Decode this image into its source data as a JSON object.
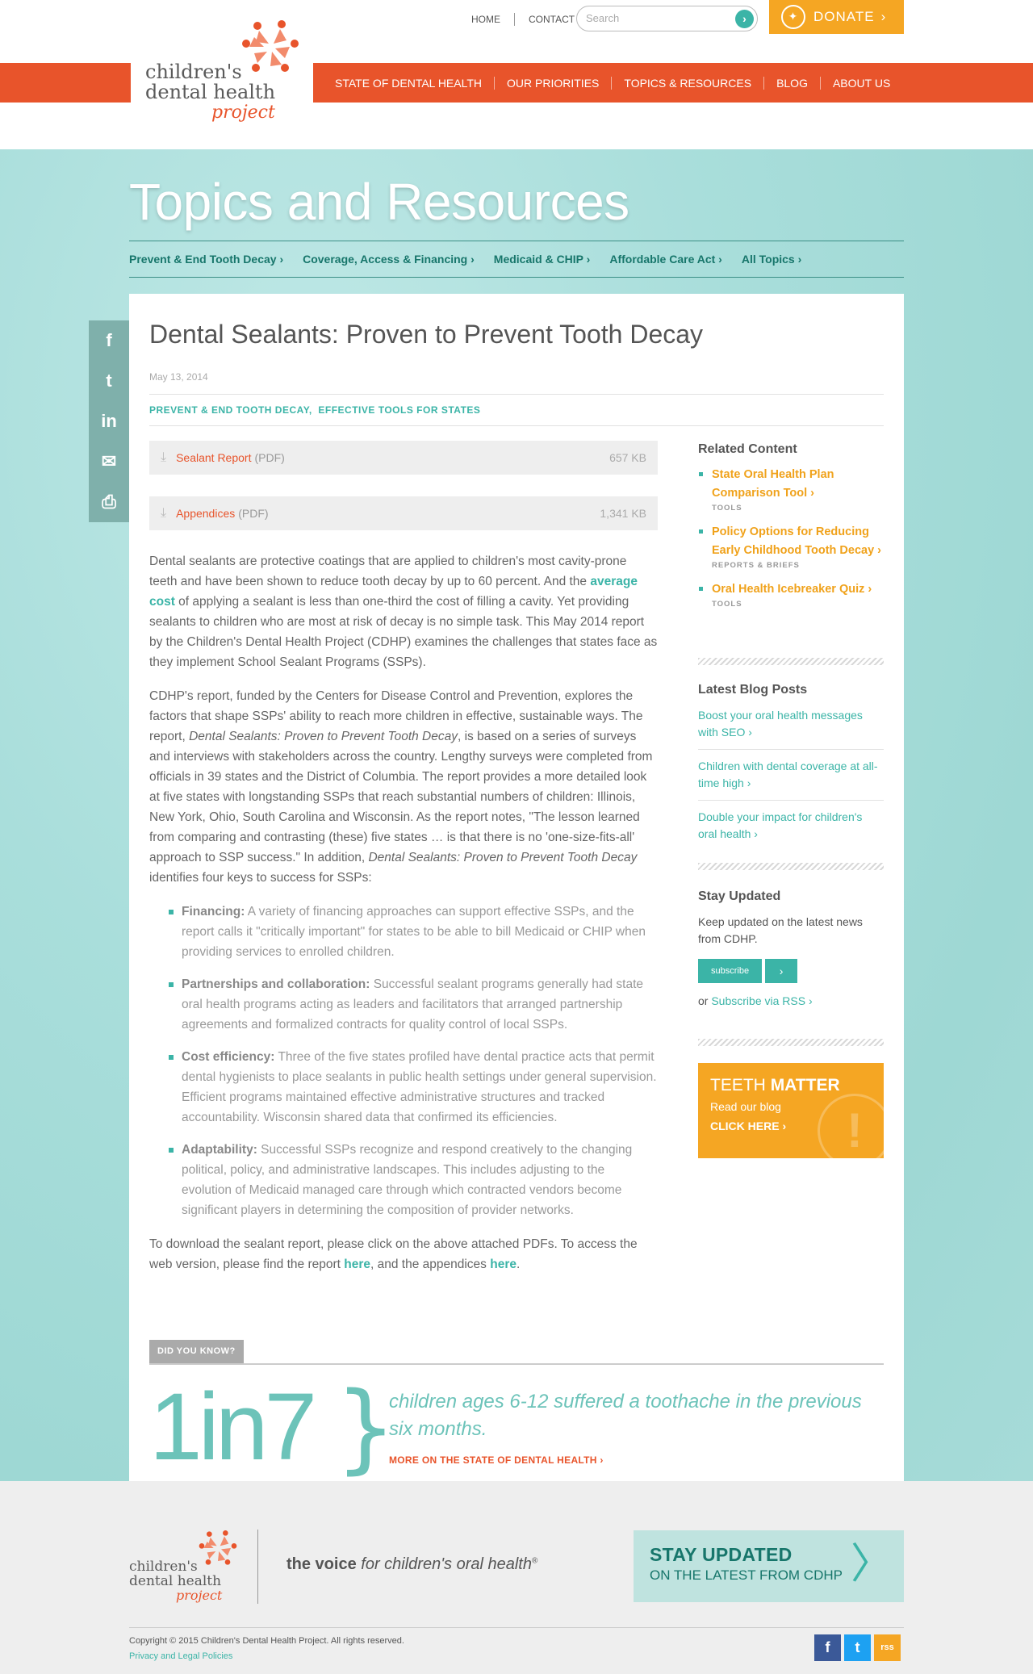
{
  "header": {
    "topnav": [
      "HOME",
      "CONTACT"
    ],
    "search_placeholder": "Search",
    "donate_label": "DONATE",
    "donate_arrow": "›",
    "logo_line1": "children's",
    "logo_line2": "dental health",
    "logo_line3": "project",
    "mainnav": [
      "STATE OF DENTAL HEALTH",
      "OUR PRIORITIES",
      "TOPICS & RESOURCES",
      "BLOG",
      "ABOUT US"
    ]
  },
  "hero": {
    "title": "Topics and Resources",
    "subnav": [
      "Prevent & End Tooth Decay ›",
      "Coverage, Access & Financing ›",
      "Medicaid & CHIP ›",
      "Affordable Care Act ›",
      "All Topics ›"
    ]
  },
  "share": {
    "icons": [
      "facebook-icon",
      "twitter-icon",
      "linkedin-icon",
      "email-icon",
      "print-icon"
    ],
    "glyphs": [
      "f",
      "t",
      "in",
      "✉",
      "⎙"
    ]
  },
  "article": {
    "title": "Dental Sealants: Proven to Prevent Tooth Decay",
    "date": "May 13, 2014",
    "tag1": "PREVENT & END TOOTH DECAY",
    "tag_sep": ",",
    "tag2": "EFFECTIVE TOOLS FOR STATES",
    "downloads": [
      {
        "name": "Sealant Report",
        "type": "(PDF)",
        "size": "657 KB"
      },
      {
        "name": "Appendices",
        "type": "(PDF)",
        "size": "1,341 KB"
      }
    ],
    "p1_a": "Dental sealants are protective coatings that are applied to children's most cavity-prone teeth and have been shown to reduce tooth decay by up to 60 percent. And the ",
    "p1_link": "average cost",
    "p1_b": " of applying a sealant is less than one-third the cost of filling a cavity. Yet providing sealants to children who are most at risk of decay is no simple task. This May 2014 report by the Children's Dental Health Project (CDHP) examines the challenges that states face as they implement School Sealant Programs (SSPs).",
    "p2_a": "CDHP's report, funded by the Centers for Disease Control and Prevention, explores the factors that shape SSPs' ability to reach more children in effective, sustainable ways. The report, ",
    "p2_i1": "Dental Sealants: Proven to Prevent Tooth Decay",
    "p2_b": ", is based on a series of surveys and interviews with stakeholders across the country. Lengthy surveys were completed from officials in 39 states and the District of Columbia. The report provides a more detailed look at five states with longstanding SSPs that reach substantial numbers of children: Illinois, New York, Ohio, South Carolina and Wisconsin. As the report notes, \"The lesson learned from comparing and contrasting (these) five states … is that there is no 'one-size-fits-all' approach to SSP success.\" In addition, ",
    "p2_i2": "Dental Sealants: Proven to Prevent Tooth Decay",
    "p2_c": " identifies four keys to success for SSPs:",
    "keys": [
      {
        "label": "Financing:",
        "text": " A variety of financing approaches can support effective SSPs, and the report calls it \"critically important\" for states to be able to bill Medicaid or CHIP when providing services to enrolled children."
      },
      {
        "label": "Partnerships and collaboration:",
        "text": " Successful sealant programs generally had state oral health programs acting as leaders and facilitators that arranged partnership agreements and formalized contracts for quality control of local SSPs."
      },
      {
        "label": "Cost efficiency:",
        "text": " Three of the five states profiled have dental practice acts that permit dental hygienists to place sealants in public health settings under general supervision. Efficient programs maintained effective administrative structures and tracked accountability. Wisconsin shared data that confirmed its efficiencies."
      },
      {
        "label": "Adaptability:",
        "text": " Successful SSPs recognize and respond creatively to the changing political, policy, and administrative landscapes. This includes adjusting to the evolution of Medicaid managed care through which contracted vendors become significant players in determining the composition of provider networks."
      }
    ],
    "p3_a": "To download the sealant report, please click on the above attached PDFs. To access the web version, please find the report ",
    "p3_link1": "here",
    "p3_b": ", and the appendices ",
    "p3_link2": "here",
    "p3_c": "."
  },
  "sidebar": {
    "related_title": "Related Content",
    "related": [
      {
        "title": "State Oral Health Plan Comparison Tool ›",
        "cat": "TOOLS"
      },
      {
        "title": "Policy Options for Reducing Early Childhood Tooth Decay ›",
        "cat": "REPORTS & BRIEFS"
      },
      {
        "title": "Oral Health Icebreaker Quiz ›",
        "cat": "TOOLS"
      }
    ],
    "blog_title": "Latest Blog Posts",
    "blog": [
      "Boost your oral health messages with SEO ›",
      "Children with dental coverage at all-time high ›",
      "Double your impact for children's oral health ›"
    ],
    "updated_title": "Stay Updated",
    "updated_text": "Keep updated on the latest news from CDHP.",
    "subscribe_label": "subscribe",
    "subscribe_arrow": "›",
    "rss_prefix": "or ",
    "rss_link": "Subscribe via RSS ›",
    "teeth_a": "TEETH",
    "teeth_b": "MATTER",
    "teeth_read": "Read our blog",
    "teeth_click": "CLICK HERE ›",
    "teeth_bang": "!"
  },
  "didyouknow": {
    "tab": "DID YOU KNOW?",
    "stat": "1in7",
    "brace": "}",
    "text": "children ages 6-12 suffered a toothache in the previous six months.",
    "link": "MORE ON THE STATE OF DENTAL HEALTH ›"
  },
  "footer": {
    "logo_line1": "children's",
    "logo_line2": "dental health",
    "logo_line3": "project",
    "voice_bold": "the voice",
    "voice_italic": " for children's oral health",
    "voice_mark": "®",
    "stay_a": "STAY UPDATED",
    "stay_b": "ON THE LATEST FROM CDHP",
    "stay_arrow": "〉",
    "copyright": "Copyright © 2015 Children's Dental Health Project. All rights reserved.",
    "privacy": "Privacy and Legal Policies",
    "social_glyphs": [
      "f",
      "t",
      "rss"
    ],
    "social_colors": [
      "#3b5998",
      "#1da1f2",
      "#f5a623"
    ]
  },
  "colors": {
    "brand_red": "#e8542b",
    "brand_teal": "#3bb4a7",
    "brand_orange": "#f5a623"
  }
}
